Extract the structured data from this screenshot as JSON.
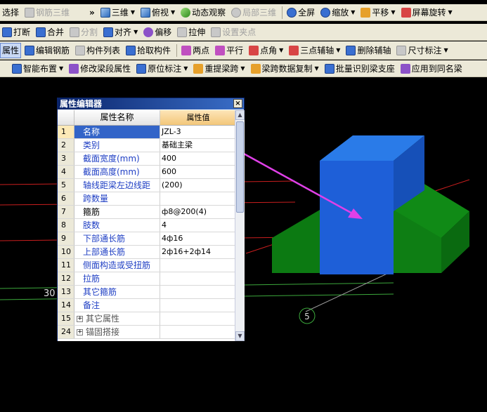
{
  "toolbar1": {
    "items": [
      "选择",
      "钢筋三维",
      "»",
      "三维",
      "俯视",
      "动态观察",
      "局部三维",
      "全屏",
      "缩放",
      "平移",
      "屏幕旋转"
    ]
  },
  "toolbar2": {
    "items": [
      "打断",
      "合并",
      "分割",
      "对齐",
      "偏移",
      "拉伸",
      "设置夹点"
    ]
  },
  "toolbar3": {
    "items": [
      "属性",
      "编辑钢筋",
      "构件列表",
      "拾取构件",
      "两点",
      "平行",
      "点角",
      "三点辅轴",
      "删除辅轴",
      "尺寸标注"
    ]
  },
  "toolbar4": {
    "items": [
      "智能布置",
      "修改梁段属性",
      "原位标注",
      "重提梁跨",
      "梁跨数据复制",
      "批量识别梁支座",
      "应用到同名梁"
    ]
  },
  "viewport": {
    "label_30": "30",
    "axis_label": "5"
  },
  "property_editor": {
    "title": "属性编辑器",
    "close": "×",
    "header_name": "属性名称",
    "header_value": "属性值",
    "rows": [
      {
        "num": "1",
        "name": "名称",
        "value": "JZL-3"
      },
      {
        "num": "2",
        "name": "类别",
        "value": "基础主梁"
      },
      {
        "num": "3",
        "name": "截面宽度(mm)",
        "value": "400"
      },
      {
        "num": "4",
        "name": "截面高度(mm)",
        "value": "600"
      },
      {
        "num": "5",
        "name": "轴线距梁左边线距",
        "value": "(200)"
      },
      {
        "num": "6",
        "name": "跨数量",
        "value": ""
      },
      {
        "num": "7",
        "name": "箍筋",
        "value": "ф8@200(4)"
      },
      {
        "num": "8",
        "name": "肢数",
        "value": "4"
      },
      {
        "num": "9",
        "name": "下部通长筋",
        "value": "4ф16"
      },
      {
        "num": "10",
        "name": "上部通长筋",
        "value": "2ф16+2ф14"
      },
      {
        "num": "11",
        "name": "侧面构造或受扭筋",
        "value": ""
      },
      {
        "num": "12",
        "name": "拉筋",
        "value": ""
      },
      {
        "num": "13",
        "name": "其它箍筋",
        "value": ""
      },
      {
        "num": "14",
        "name": "备注",
        "value": ""
      },
      {
        "num": "15",
        "name": "其它属性",
        "value": ""
      },
      {
        "num": "24",
        "name": "锚固搭接",
        "value": ""
      }
    ]
  },
  "colors": {
    "beam_blue": "#1e5fd8",
    "base_green": "#0c7a12",
    "annotation_magenta": "#e040e8",
    "red_line": "#c81e1e"
  }
}
